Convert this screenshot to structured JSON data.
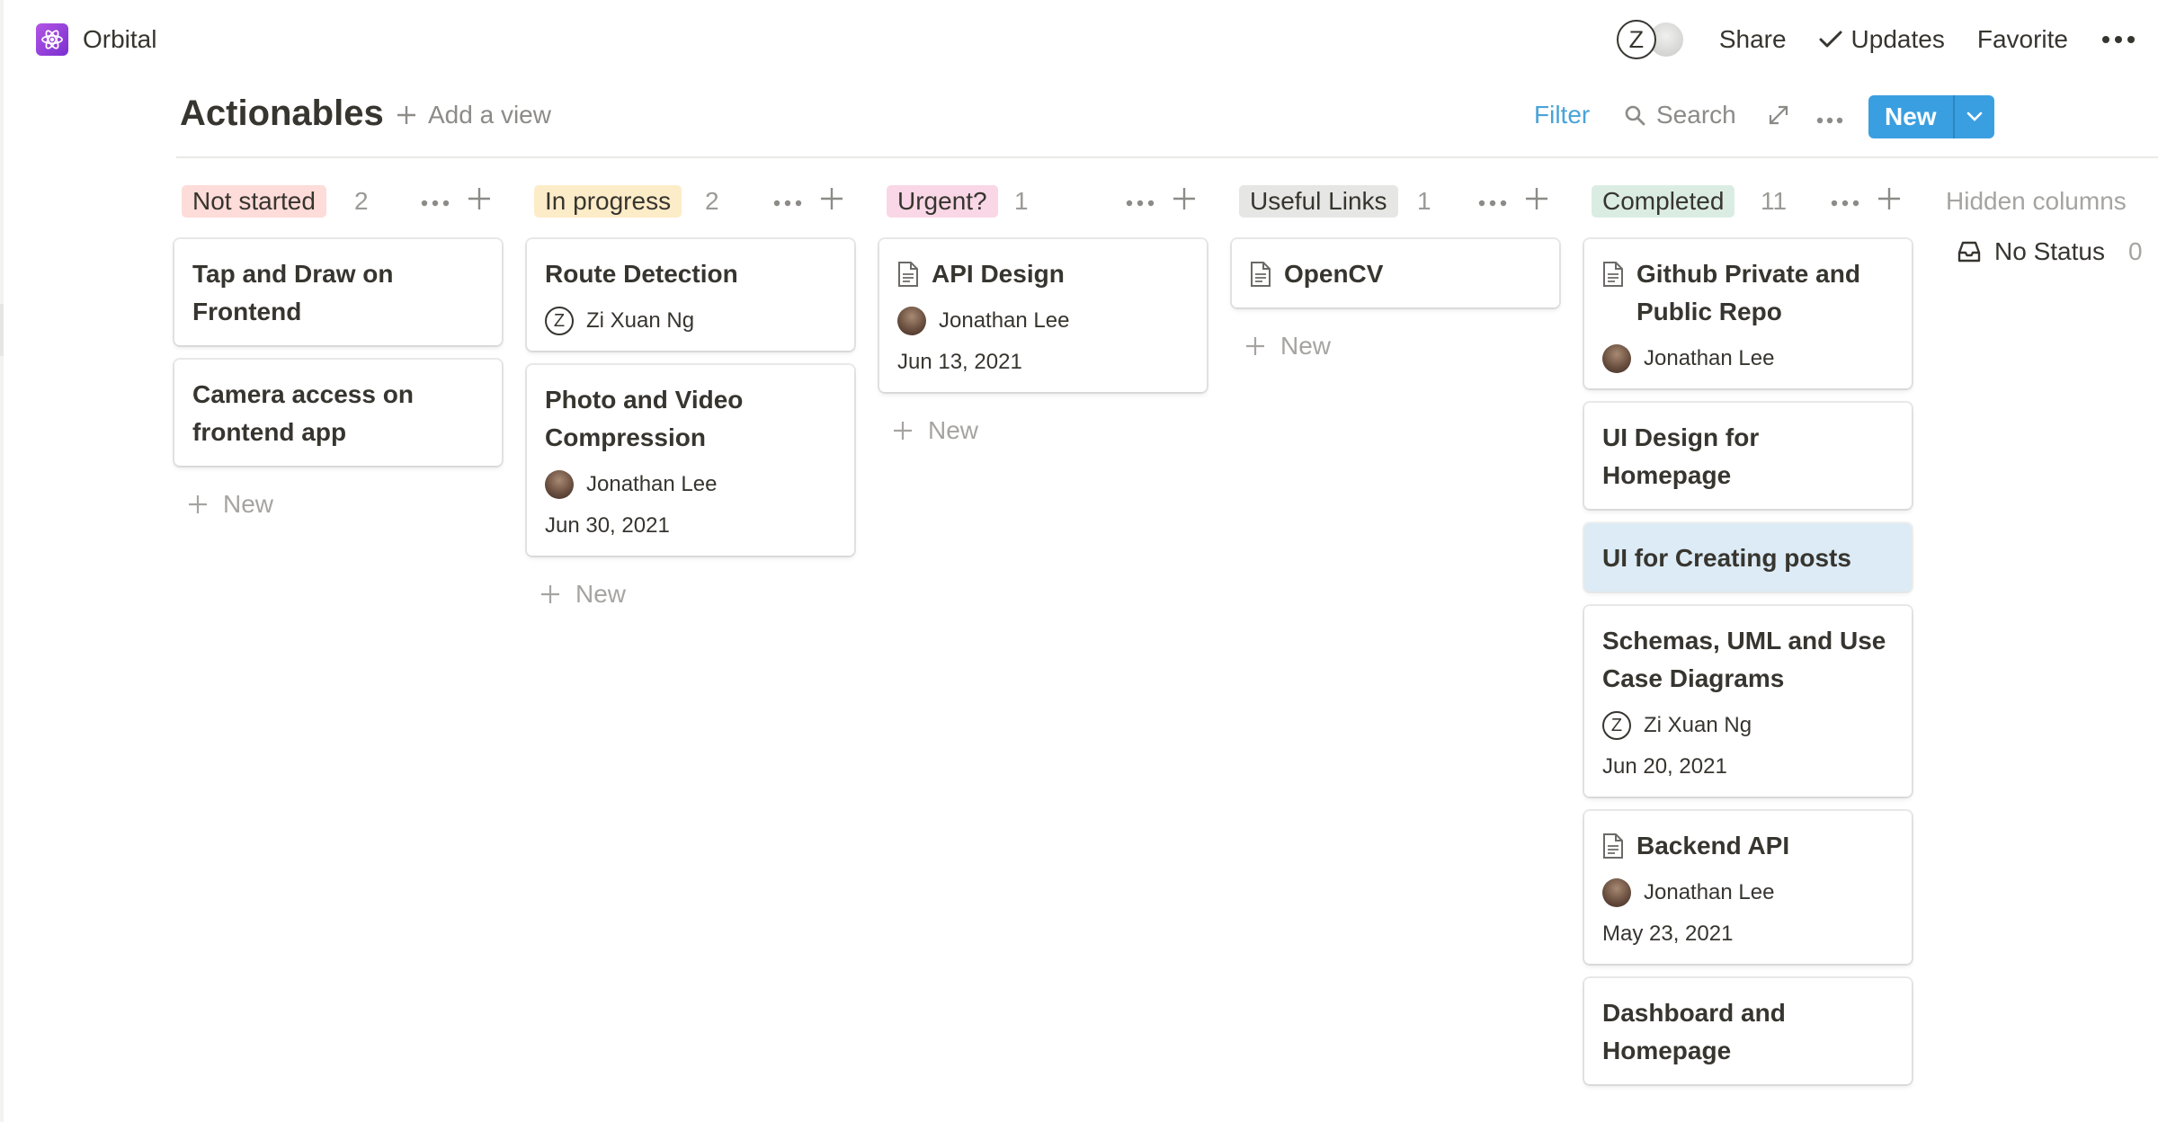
{
  "workspace": {
    "name": "Orbital",
    "logo_icon": "atom-icon",
    "logo_color": "#9b3fdb"
  },
  "topbar": {
    "avatar_initial": "Z",
    "share_label": "Share",
    "updates_label": "Updates",
    "favorite_label": "Favorite"
  },
  "page": {
    "title": "Actionables",
    "add_view_label": "Add a view",
    "filter_label": "Filter",
    "search_label": "Search",
    "new_label": "New"
  },
  "colors": {
    "accent": "#3a9fe0",
    "filter": "#4aa3d8",
    "highlight_card": "#dcebf5"
  },
  "columns": [
    {
      "label": "Not started",
      "count": "2",
      "pill_color": "#fddcd9",
      "new_label": "New",
      "cards": [
        {
          "title": "Tap and Draw on Frontend"
        },
        {
          "title": "Camera access on frontend app"
        }
      ]
    },
    {
      "label": "In progress",
      "count": "2",
      "pill_color": "#fdecc8",
      "new_label": "New",
      "cards": [
        {
          "title": "Route Detection",
          "person": "Zi Xuan Ng",
          "person_initial": "Z"
        },
        {
          "title": "Photo and Video Compression",
          "person": "Jonathan Lee",
          "date": "Jun 30, 2021"
        }
      ]
    },
    {
      "label": "Urgent?",
      "count": "1",
      "pill_color": "#f9d7e6",
      "new_label": "New",
      "cards": [
        {
          "title": "API Design",
          "person": "Jonathan Lee",
          "date": "Jun 13, 2021"
        }
      ]
    },
    {
      "label": "Useful Links",
      "count": "1",
      "pill_color": "#e6e6e4",
      "new_label": "New",
      "cards": [
        {
          "title": "OpenCV"
        }
      ]
    },
    {
      "label": "Completed",
      "count": "11",
      "pill_color": "#dbede3",
      "cards": [
        {
          "title": "Github Private and Public Repo",
          "person": "Jonathan Lee"
        },
        {
          "title": "UI Design for Homepage"
        },
        {
          "title": "UI for Creating posts"
        },
        {
          "title": "Schemas, UML and Use Case Diagrams",
          "person": "Zi Xuan Ng",
          "person_initial": "Z",
          "date": "Jun 20, 2021"
        },
        {
          "title": "Backend API",
          "person": "Jonathan Lee",
          "date": "May 23, 2021"
        },
        {
          "title": "Dashboard and Homepage"
        }
      ]
    }
  ],
  "hidden_columns": {
    "title": "Hidden columns",
    "items": [
      {
        "label": "No Status",
        "count": "0"
      }
    ]
  }
}
